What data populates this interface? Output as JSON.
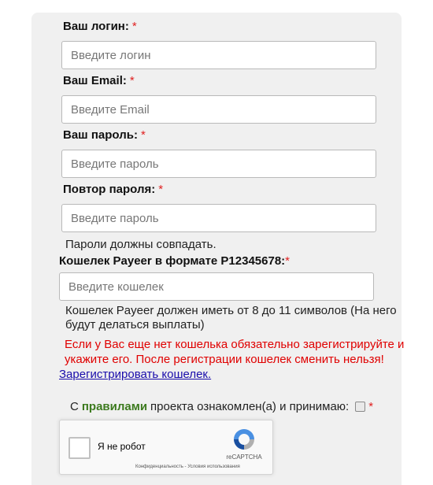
{
  "form": {
    "login": {
      "label": "Ваш логин:",
      "required": "*",
      "placeholder": "Введите логин"
    },
    "email": {
      "label": "Ваш Email:",
      "required": "*",
      "placeholder": "Введите Email"
    },
    "password": {
      "label": "Ваш пароль:",
      "required": "*",
      "placeholder": "Введите пароль"
    },
    "password_repeat": {
      "label": "Повтор пароля:",
      "required": "*",
      "placeholder": "Введите пароль"
    },
    "password_hint": "Пароли должны совпадать.",
    "wallet": {
      "label": "Кошелек Payeer в формате P12345678:",
      "required": "*",
      "placeholder": "Введите кошелек"
    },
    "wallet_hint": "Кошелек Payeer должен иметь от 8 до 11 символов (На него будут делаться выплаты)",
    "wallet_warning": "Если у Вас еще нет кошелька обязательно зарегистрируйте и укажите его. После регистрации кошелек сменить нельзя!",
    "register_wallet_link": "Зарегистрировать кошелек.",
    "agree": {
      "prefix": "С",
      "rules_link": "правилами",
      "suffix": "проекта ознакомлен(а) и принимаю:",
      "required": "*",
      "checked": false
    }
  },
  "recaptcha": {
    "label": "Я не робот",
    "brand": "reCAPTCHA",
    "terms": "Конфиденциальность - Условия использования"
  },
  "colors": {
    "required": "#e02020",
    "warning": "#e00000",
    "link": "#1a0dab",
    "rules_link": "#3c7a1e",
    "panel_bg": "#f0f0f0"
  }
}
